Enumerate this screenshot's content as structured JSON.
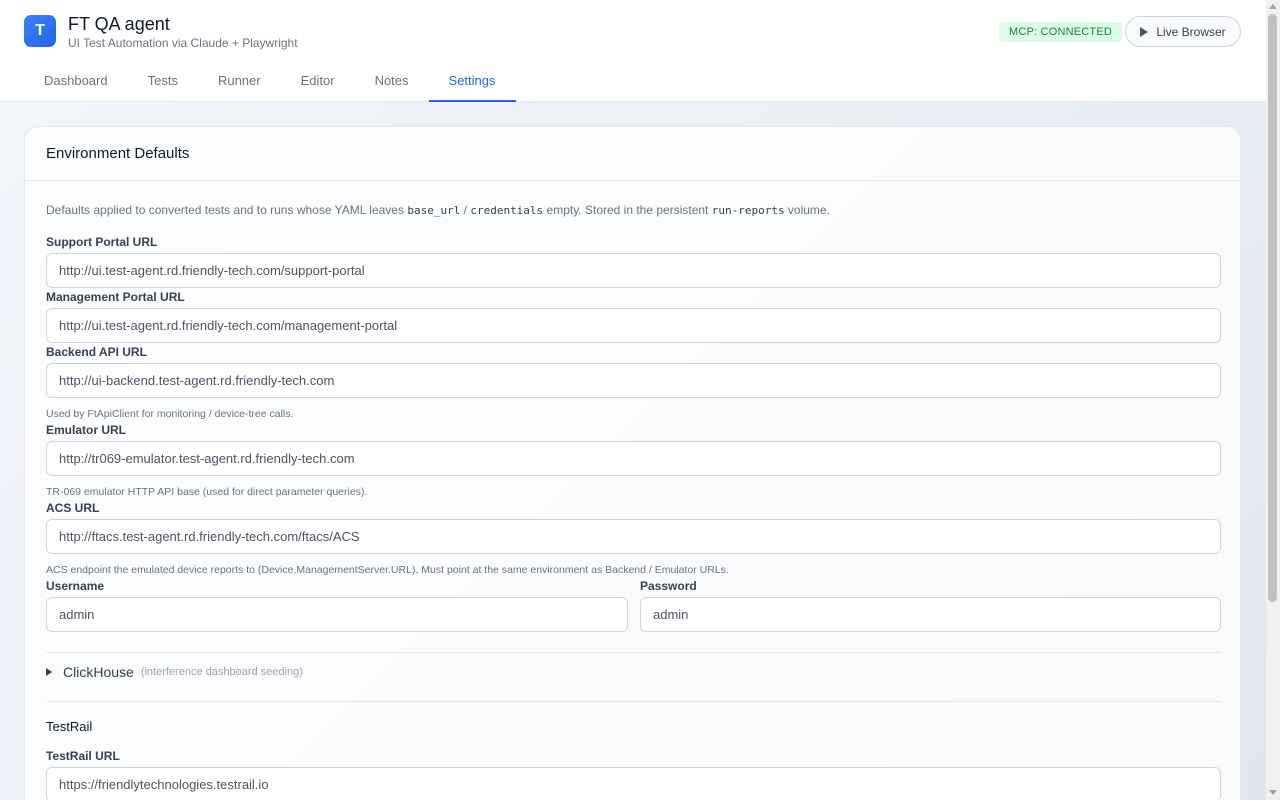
{
  "app": {
    "logo_letter": "T",
    "title": "FT QA agent",
    "subtitle": "UI Test Automation via Claude + Playwright",
    "mcp_status": "MCP: CONNECTED",
    "live_browser_label": "Live Browser"
  },
  "tabs": [
    {
      "label": "Dashboard"
    },
    {
      "label": "Tests"
    },
    {
      "label": "Runner"
    },
    {
      "label": "Editor"
    },
    {
      "label": "Notes"
    },
    {
      "label": "Settings",
      "active": true
    }
  ],
  "settings": {
    "card_title": "Environment Defaults",
    "description": {
      "part1": "Defaults applied to converted tests and to runs whose YAML leaves ",
      "code1": "base_url",
      "part2": " / ",
      "code2": "credentials",
      "part3": " empty. Stored in the persistent ",
      "code3": "run-reports",
      "part4": " volume."
    },
    "support_portal": {
      "label": "Support Portal URL",
      "value": "http://ui.test-agent.rd.friendly-tech.com/support-portal"
    },
    "management_portal": {
      "label": "Management Portal URL",
      "value": "http://ui.test-agent.rd.friendly-tech.com/management-portal"
    },
    "backend_api": {
      "label": "Backend API URL",
      "value": "http://ui-backend.test-agent.rd.friendly-tech.com",
      "hint": "Used by FtApiClient for monitoring / device-tree calls."
    },
    "emulator": {
      "label": "Emulator URL",
      "value": "http://tr069-emulator.test-agent.rd.friendly-tech.com",
      "hint": "TR-069 emulator HTTP API base (used for direct parameter queries)."
    },
    "acs": {
      "label": "ACS URL",
      "value": "http://ftacs.test-agent.rd.friendly-tech.com/ftacs/ACS",
      "hint": "ACS endpoint the emulated device reports to (Device.ManagementServer.URL). Must point at the same environment as Backend / Emulator URLs."
    },
    "username": {
      "label": "Username",
      "value": "admin"
    },
    "password": {
      "label": "Password",
      "value": "admin"
    },
    "clickhouse": {
      "title": "ClickHouse",
      "subtitle": "(interference dashboard seeding)"
    },
    "testrail": {
      "title": "TestRail",
      "url_label": "TestRail URL",
      "url_value": "https://friendlytechnologies.testrail.io"
    }
  }
}
